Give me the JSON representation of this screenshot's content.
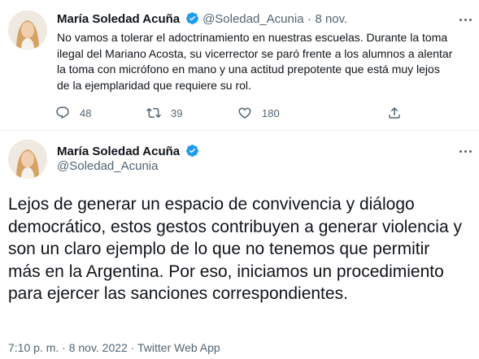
{
  "colors": {
    "text": "#0f1419",
    "secondary": "#536471",
    "verified": "#1d9bf0",
    "divider": "#eff3f4"
  },
  "tweet1": {
    "author_name": "María Soledad Acuña",
    "handle": "@Soledad_Acunia",
    "separator": "·",
    "date": "8 nov.",
    "text": "No vamos a tolerar el adoctrinamiento en nuestras escuelas. Durante la toma ilegal del Mariano Acosta, su vicerrector se paró frente a los alumnos a alentar la toma con micrófono en mano y una actitud prepotente que está muy lejos de la ejemplaridad que requiere su rol.",
    "replies": "48",
    "retweets": "39",
    "likes": "180"
  },
  "tweet2": {
    "author_name": "María Soledad Acuña",
    "handle": "@Soledad_Acunia",
    "text": "Lejos de generar un espacio de convivencia y diálogo democrático, estos gestos contribuyen a generar violencia y son un claro ejemplo de lo que no tenemos que permitir más en la Argentina. Por eso, iniciamos un procedimiento para ejercer las sanciones correspondientes.",
    "timestamp": "7:10 p. m. · 8 nov. 2022 · Twitter Web App"
  },
  "icons": {
    "verified": "verified-badge-icon",
    "more": "more-icon",
    "reply": "reply-icon",
    "retweet": "retweet-icon",
    "like": "heart-icon",
    "share": "share-icon"
  }
}
